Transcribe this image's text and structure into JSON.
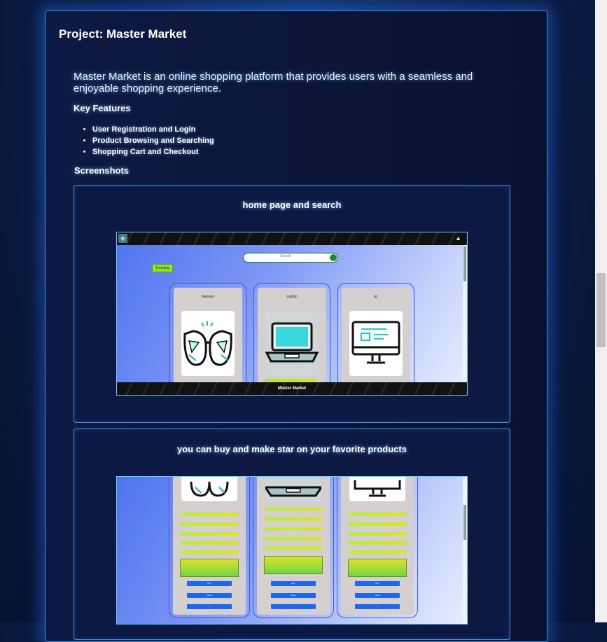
{
  "project": {
    "title": "Project: Master Market",
    "description": "Master Market is an online shopping platform that provides users with a seamless and enjoyable shopping experience.",
    "key_features_heading": "Key Features",
    "features": [
      "User Registration and Login",
      "Product Browsing and Searching",
      "Shopping Cart and Checkout"
    ],
    "screenshots_heading": "Screenshots"
  },
  "screenshots": [
    {
      "caption": "home page and search",
      "app": {
        "search_placeholder": "Search",
        "trending_label": "Trending",
        "footer_title": "Master Market",
        "products": [
          {
            "name": "Glasses",
            "icon": "glasses-icon"
          },
          {
            "name": "Laptop",
            "icon": "laptop-icon"
          },
          {
            "name": "pc",
            "icon": "monitor-icon"
          }
        ]
      }
    },
    {
      "caption": "you can buy and make star on your favorite products",
      "app": {
        "buttons": [
          "Buy",
          "Save",
          "☆"
        ]
      }
    }
  ],
  "colors": {
    "accent_border": "#3f8fd6",
    "glow": "#1e6bff",
    "tag_green": "#8ee62a",
    "button_blue": "#1d67f0"
  }
}
